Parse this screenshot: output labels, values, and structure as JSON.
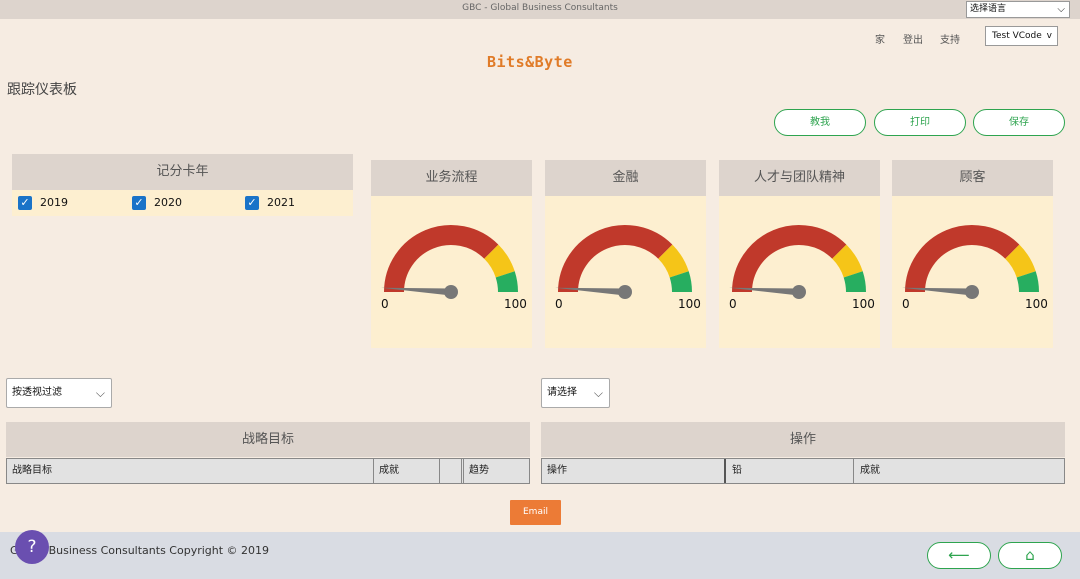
{
  "topbar": {
    "title": "GBC - Global Business Consultants",
    "language_selected": "选择语言"
  },
  "nav": {
    "home": "家",
    "logout": "登出",
    "support": "支持",
    "user": "Test VCode",
    "user_chevron": "v"
  },
  "logo": "Bits&Byte",
  "page_title": "跟踪仪表板",
  "actions": {
    "teach": "教我",
    "print": "打印",
    "save": "保存"
  },
  "scorecard": {
    "title": "记分卡年",
    "years": [
      {
        "label": "2019",
        "checked": true
      },
      {
        "label": "2020",
        "checked": true
      },
      {
        "label": "2021",
        "checked": true
      }
    ]
  },
  "gauges": [
    {
      "title": "业务流程",
      "min": "0",
      "max": "100",
      "value": 0
    },
    {
      "title": "金融",
      "min": "0",
      "max": "100",
      "value": 0
    },
    {
      "title": "人才与团队精神",
      "min": "0",
      "max": "100",
      "value": 0
    },
    {
      "title": "顾客",
      "min": "0",
      "max": "100",
      "value": 0
    }
  ],
  "gauge_colors": {
    "red": "#c0392b",
    "yellow": "#f5c518",
    "green": "#27ae60",
    "needle": "#777777"
  },
  "filters": {
    "perspective": "按透视过滤",
    "select": "请选择"
  },
  "strategic": {
    "title": "战略目标",
    "columns": [
      "战略目标",
      "成就",
      "",
      "趋势"
    ]
  },
  "operations": {
    "title": "操作",
    "columns": [
      "操作",
      "铅",
      "成就"
    ]
  },
  "email_label": "Email",
  "footer": {
    "copyright": "Global Business Consultants Copyright © 2019",
    "help": "?",
    "back_icon": "⟵",
    "home_icon": "⌂"
  }
}
